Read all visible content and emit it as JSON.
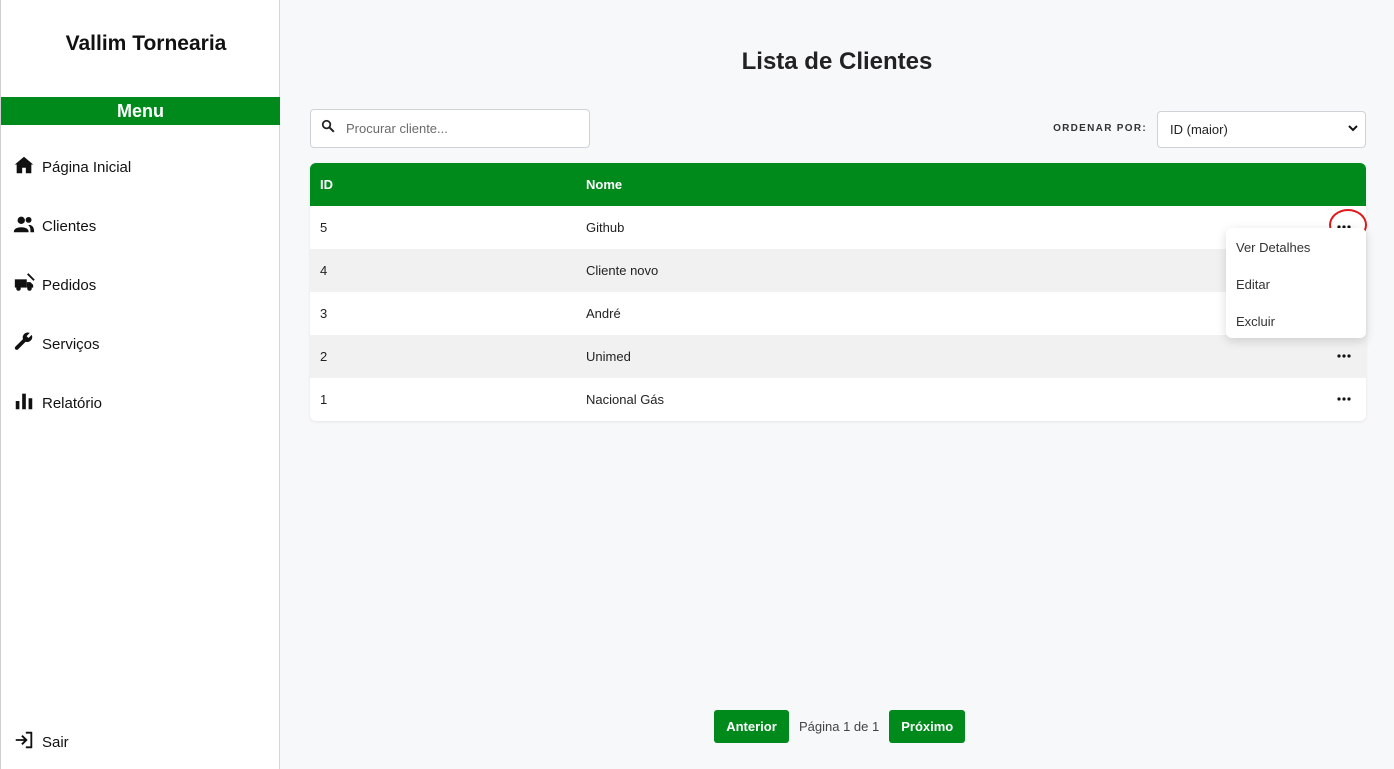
{
  "sidebar": {
    "brand": "Vallim Tornearia",
    "menu_title": "Menu",
    "items": [
      {
        "label": "Página Inicial",
        "icon": "home-icon"
      },
      {
        "label": "Clientes",
        "icon": "users-icon"
      },
      {
        "label": "Pedidos",
        "icon": "truck-icon"
      },
      {
        "label": "Serviços",
        "icon": "wrench-icon"
      },
      {
        "label": "Relatório",
        "icon": "bar-chart-icon"
      }
    ],
    "logout_label": "Sair"
  },
  "main": {
    "title": "Lista de Clientes",
    "search": {
      "placeholder": "Procurar cliente...",
      "value": ""
    },
    "sort": {
      "label": "ORDENAR POR:",
      "selected": "ID (maior)"
    },
    "table": {
      "headers": {
        "id": "ID",
        "name": "Nome"
      },
      "rows": [
        {
          "id": "5",
          "name": "Github"
        },
        {
          "id": "4",
          "name": "Cliente novo"
        },
        {
          "id": "3",
          "name": "André"
        },
        {
          "id": "2",
          "name": "Unimed"
        },
        {
          "id": "1",
          "name": "Nacional Gás"
        }
      ]
    },
    "row_menu": {
      "options": [
        "Ver Detalhes",
        "Editar",
        "Excluir"
      ]
    },
    "pagination": {
      "prev_label": "Anterior",
      "info": "Página 1 de 1",
      "next_label": "Próximo"
    }
  },
  "colors": {
    "brand_green": "#008a1c",
    "highlight_red": "#e0191b"
  }
}
